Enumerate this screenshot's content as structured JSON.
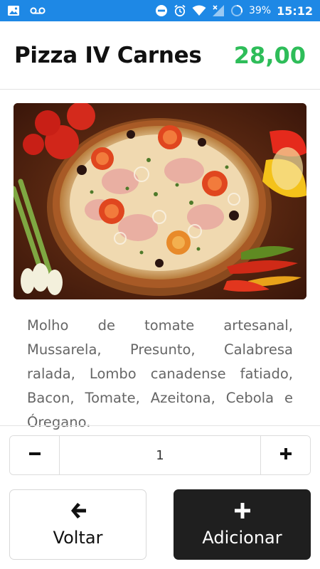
{
  "status_bar": {
    "battery": "39%",
    "time": "15:12"
  },
  "product": {
    "title": "Pizza IV Carnes",
    "price": "28,00",
    "description": "Molho de tomate artesanal, Mussarela, Presunto, Calabresa ralada, Lombo canadense fatiado, Bacon, Tomate, Azeitona, Cebola e Óregano."
  },
  "quantity": {
    "value": "1"
  },
  "actions": {
    "back_label": "Voltar",
    "add_label": "Adicionar"
  },
  "colors": {
    "status_bar": "#1e88e5",
    "price": "#2ebd59",
    "add_button": "#1f1f1f"
  },
  "icons": {
    "back": "arrow-left-icon",
    "add": "plus-icon",
    "decrease": "minus-icon",
    "increase": "plus-icon"
  }
}
